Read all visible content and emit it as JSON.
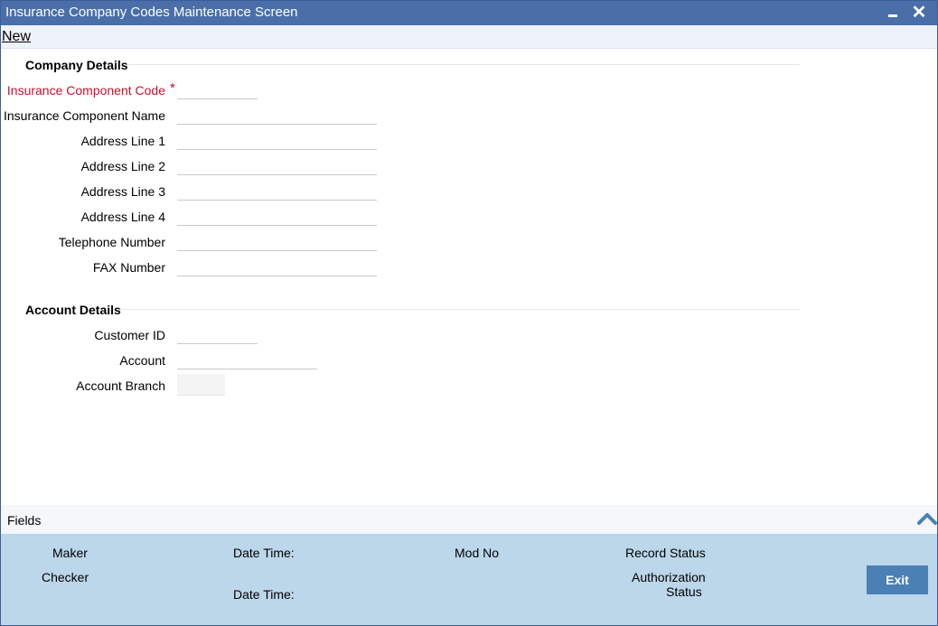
{
  "window": {
    "title": "Insurance Company Codes Maintenance Screen",
    "minimize_icon": "minimize-icon",
    "close_icon": "close-icon"
  },
  "toolbar": {
    "new_label": "New"
  },
  "company_details": {
    "title": "Company Details",
    "fields": {
      "component_code": {
        "label": "Insurance Component Code",
        "required_mark": "*",
        "value": ""
      },
      "component_name": {
        "label": "Insurance Component Name",
        "value": ""
      },
      "address_1": {
        "label": "Address Line 1",
        "value": ""
      },
      "address_2": {
        "label": "Address Line 2",
        "value": ""
      },
      "address_3": {
        "label": "Address Line 3",
        "value": ""
      },
      "address_4": {
        "label": "Address Line 4",
        "value": ""
      },
      "telephone": {
        "label": "Telephone Number",
        "value": ""
      },
      "fax": {
        "label": "FAX Number",
        "value": ""
      }
    }
  },
  "account_details": {
    "title": "Account Details",
    "fields": {
      "customer_id": {
        "label": "Customer ID",
        "value": ""
      },
      "account": {
        "label": "Account",
        "value": ""
      },
      "account_branch": {
        "label": "Account Branch",
        "value": ""
      }
    }
  },
  "fields_bar": {
    "label": "Fields",
    "icon": "chevron-up-icon"
  },
  "footer": {
    "maker": "Maker",
    "checker": "Checker",
    "date_time_1": "Date Time:",
    "date_time_2": "Date Time:",
    "mod_no": "Mod No",
    "record_status": "Record Status",
    "authorization_status_line1": "Authorization",
    "authorization_status_line2": "Status",
    "exit_label": "Exit"
  },
  "colors": {
    "titlebar": "#4a6fa8",
    "footer": "#bcd6ea",
    "exit_button": "#4a80b4",
    "required": "#c8102e"
  }
}
